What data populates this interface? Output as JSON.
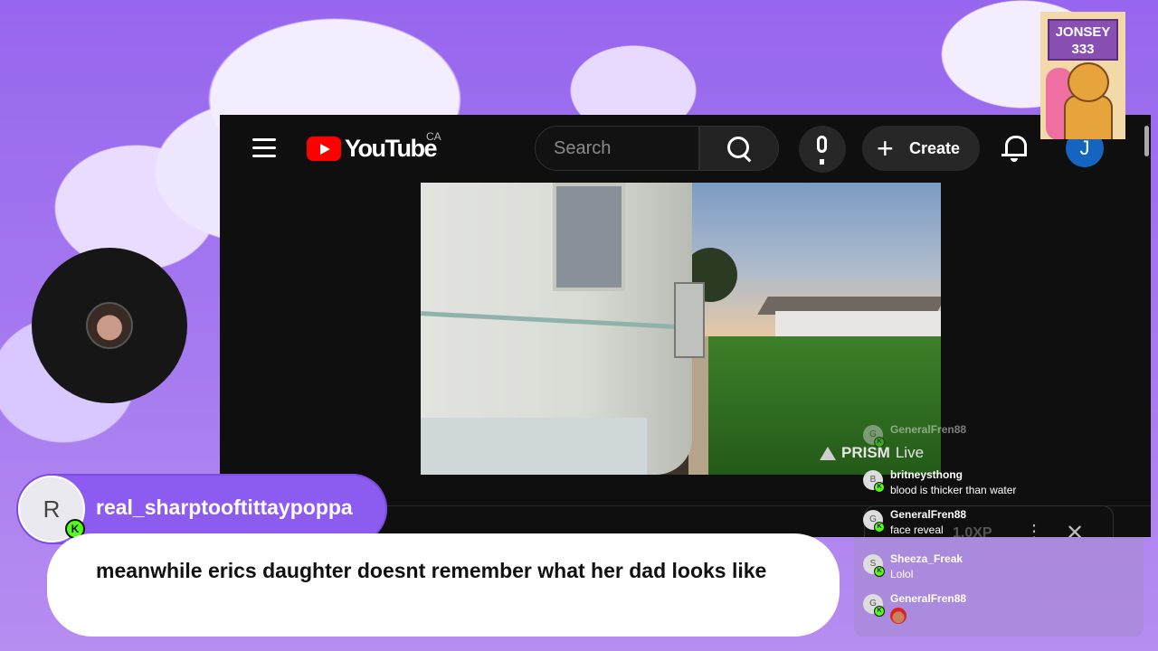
{
  "youtube": {
    "logo_text": "YouTube",
    "country_code": "CA",
    "search_placeholder": "Search",
    "create_label": "Create",
    "create_plus": "+",
    "avatar_initial": "J",
    "watermark_brand": "PRISM",
    "watermark_suffix": "Live",
    "bottom_xp": "1.0XP",
    "more_glyph": "⋮",
    "close_glyph": "✕"
  },
  "sticker": {
    "line1": "JONSEY",
    "line2": "333"
  },
  "featured_message": {
    "avatar_initial": "R",
    "badge": "K",
    "username": "real_sharptooftittaypoppa",
    "text": "meanwhile erics daughter doesnt remember what her dad looks like"
  },
  "chat": {
    "messages": [
      {
        "initial": "G",
        "user": "GeneralFren88",
        "text": ""
      },
      {
        "initial": "B",
        "user": "britneysthong",
        "text": "blood is thicker than water"
      },
      {
        "initial": "G",
        "user": "GeneralFren88",
        "text": "face reveal"
      },
      {
        "initial": "S",
        "user": "Sheeza_Freak",
        "text": "Lolol"
      },
      {
        "initial": "G",
        "user": "GeneralFren88",
        "text": ""
      }
    ],
    "badge": "K"
  },
  "colors": {
    "accent_purple": "#8c5cf0",
    "kick_green": "#53fc18",
    "youtube_red": "#ff0000"
  },
  "icons": [
    "menu-icon",
    "search-icon",
    "mic-icon",
    "plus-icon",
    "bell-icon",
    "kick-badge-icon",
    "prism-logo-icon"
  ]
}
